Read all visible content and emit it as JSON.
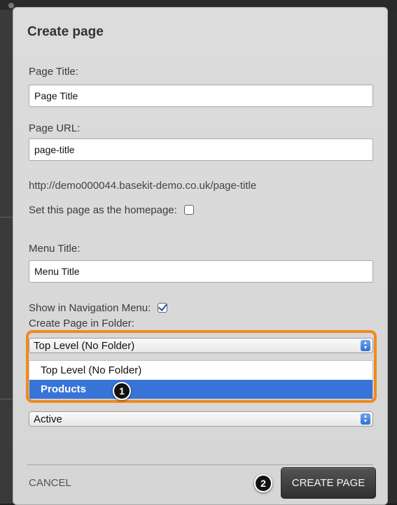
{
  "dialog": {
    "title": "Create page",
    "page_title": {
      "label": "Page Title:",
      "value": "Page Title"
    },
    "page_url": {
      "label": "Page URL:",
      "value": "page-title"
    },
    "url_preview": "http://demo000044.basekit-demo.co.uk/page-title",
    "homepage_checkbox": {
      "label": "Set this page as the homepage:",
      "checked": false
    },
    "menu_title": {
      "label": "Menu Title:",
      "value": "Menu Title"
    },
    "nav_checkbox": {
      "label": "Show in Navigation Menu:",
      "checked": true
    },
    "folder": {
      "label": "Create Page in Folder:",
      "selected": "Top Level (No Folder)",
      "options": [
        "Top Level (No Folder)",
        "Products"
      ],
      "highlighted": "Products"
    },
    "status_select": {
      "selected": "Active"
    },
    "cancel_label": "CANCEL",
    "create_label": "CREATE PAGE"
  },
  "annotations": {
    "step1": "1",
    "step2": "2",
    "highlight_color": "#f08a1c"
  },
  "colors": {
    "dialog_bg": "#d8d8d8",
    "selection_blue": "#3874d8",
    "button_dark": "#3a3a3a"
  }
}
